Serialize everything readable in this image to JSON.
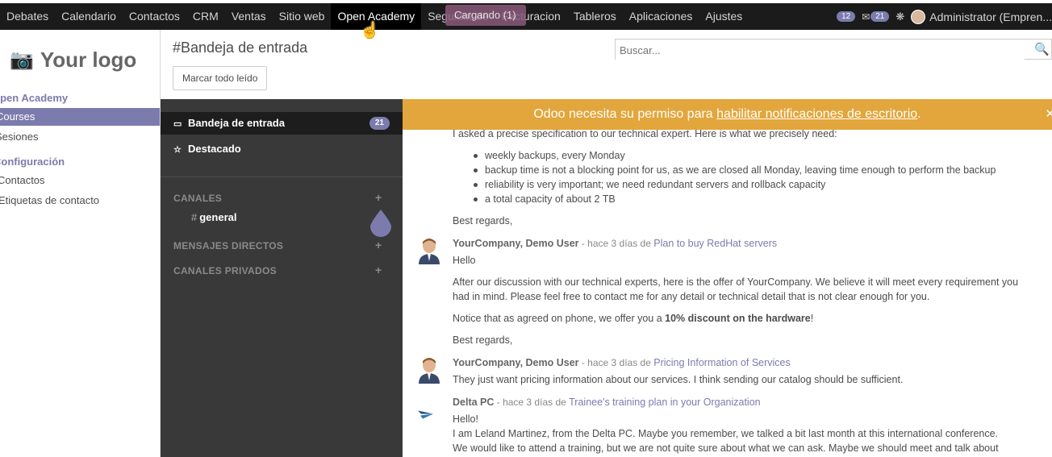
{
  "topnav": {
    "items": [
      "Debates",
      "Calendario",
      "Contactos",
      "CRM",
      "Ventas",
      "Sitio web",
      "Open Academy",
      "Seguidor de",
      "Facturacion",
      "Tableros",
      "Aplicaciones",
      "Ajustes"
    ],
    "loading": "Cargando (1)",
    "badge_activities": "12",
    "badge_messages": "21",
    "user": "Administrator (Empren..."
  },
  "sidebar": {
    "logo": "Your logo",
    "section1": "Open Academy",
    "item_courses": "Courses",
    "item_sesiones": "Sesiones",
    "section2": "Configuración",
    "item_contactos": "Contactos",
    "item_etiquetas": "Etiquetas de contacto"
  },
  "control": {
    "title": "#Bandeja de entrada",
    "mark_button": "Marcar todo leído",
    "search_placeholder": "Buscar..."
  },
  "discuss": {
    "inbox": "Bandeja de entrada",
    "inbox_count": "21",
    "starred": "Destacado",
    "channels": "CANALES",
    "channel_general": "general",
    "direct": "MENSAJES DIRECTOS",
    "private": "CANALES PRIVADOS"
  },
  "notification": {
    "prefix": "Odoo necesita su permiso para ",
    "link": "habilitar notificaciones de escritorio",
    "suffix": "."
  },
  "thread": {
    "line_top": "I asked a precise specification to our technical expert. Here is what we precisely need:",
    "bullets": [
      "weekly backups, every Monday",
      "backup time is not a blocking point for us, as we are closed all Monday, leaving time enough to perform the backup",
      "reliability is very important; we need redundant servers and rollback capacity",
      "a total capacity of about 2 TB"
    ],
    "best1": "Best regards,",
    "m1_author": "YourCompany, Demo User",
    "m1_meta": " - hace 3 días de ",
    "m1_subject": "Plan to buy RedHat servers",
    "m1_hello": "Hello",
    "m1_p1a": "After our discussion with our technical experts, here is the offer of YourCompany. We believe it will meet every requirement you",
    "m1_p1b": "had in mind. Please feel free to contact me for any detail or technical detail that is not clear enough for you.",
    "m1_p2_pre": "Notice that as agreed on phone, we offer you a ",
    "m1_p2_bold": "10% discount on the hardware",
    "m1_p2_post": "!",
    "best2": "Best regards,",
    "m2_author": "YourCompany, Demo User",
    "m2_meta": " - hace 3 días de ",
    "m2_subject": "Pricing Information of Services",
    "m2_body": "They just want pricing information about our services. I think sending our catalog should be sufficient.",
    "m3_author": "Delta PC",
    "m3_meta": " - hace 3 días de ",
    "m3_subject": "Trainee's training plan in your Organization",
    "m3_hello": "Hello!",
    "m3_p1": "I am Leland Martinez, from the Delta PC. Maybe you remember, we talked a bit last month at this international conference.",
    "m3_p2": "We would like to attend a training, but we are not quite sure about what we can ask. Maybe we should meet and talk about"
  }
}
